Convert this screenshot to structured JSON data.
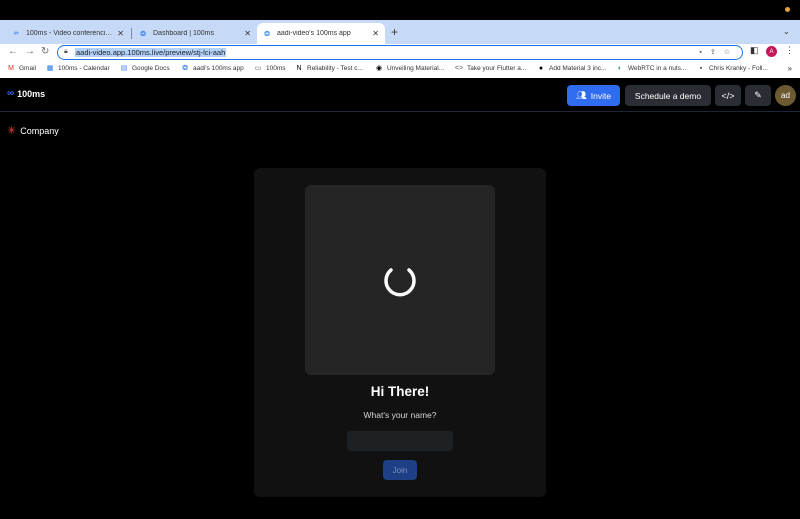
{
  "browser": {
    "tabs": [
      {
        "label": "100ms - Video conferencing a",
        "icon": "100ms-logo-icon",
        "active": false
      },
      {
        "label": "Dashboard | 100ms",
        "icon": "100ms-globe-icon",
        "active": false
      },
      {
        "label": "aadi-video's 100ms app",
        "icon": "100ms-globe-icon",
        "active": true
      }
    ],
    "url": "aadi-video.app.100ms.live/preview/stj-lci-aah",
    "profile_initial": "A",
    "bookmarks": [
      {
        "label": "Gmail",
        "icon": "gmail-icon"
      },
      {
        "label": "100ms - Calendar",
        "icon": "calendar-icon"
      },
      {
        "label": "Google Docs",
        "icon": "docs-icon"
      },
      {
        "label": "aadi's 100ms app",
        "icon": "100ms-globe-icon"
      },
      {
        "label": "100ms",
        "icon": "folder-icon"
      },
      {
        "label": "Reliability - Test c...",
        "icon": "notion-icon"
      },
      {
        "label": "Unveiling Material...",
        "icon": "medium-icon"
      },
      {
        "label": "Take your Flutter a...",
        "icon": "flutter-icon"
      },
      {
        "label": "Add Material 3 inc...",
        "icon": "github-icon"
      },
      {
        "label": "WebRTC in a nuts...",
        "icon": "webrtc-icon"
      },
      {
        "label": "Chris Kranky - Foll...",
        "icon": "ck-icon"
      }
    ]
  },
  "app": {
    "brand": "100ms",
    "company": "Company",
    "header": {
      "invite_label": "Invite",
      "demo_label": "Schedule a demo",
      "code_label": "</>",
      "user_initials": "ad"
    },
    "preview": {
      "greeting": "Hi There!",
      "prompt": "What's your name?",
      "name_value": "",
      "join_label": "Join"
    }
  }
}
